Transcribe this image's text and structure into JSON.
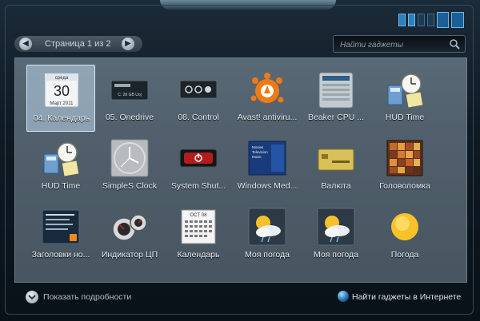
{
  "toolbar": {
    "page_label": "Страница 1 из 2",
    "search_placeholder": "Найти гаджеты"
  },
  "gadgets": [
    {
      "label": "04. Календарь",
      "icon": "calendar-icon",
      "calendar": {
        "month_top": "среда",
        "day": "30",
        "month_year": "Март 2011"
      },
      "selected": true
    },
    {
      "label": "05. Onedrive",
      "icon": "drive-icon",
      "drive_text": "C: 28 GB Uoj"
    },
    {
      "label": "08. Control",
      "icon": "control-icon"
    },
    {
      "label": "Avast! antiviru...",
      "icon": "avast-icon"
    },
    {
      "label": "Beaker CPU ...",
      "icon": "cpu-meter-icon"
    },
    {
      "label": "HUD Time",
      "icon": "clock-calculator-icon"
    },
    {
      "label": "HUD Time",
      "icon": "clock-calculator-icon"
    },
    {
      "label": "SimpleS Clock",
      "icon": "analog-clock-icon"
    },
    {
      "label": "System Shut...",
      "icon": "power-button-icon"
    },
    {
      "label": "Windows Med...",
      "icon": "media-center-icon",
      "media_lines": [
        "Movies",
        "Television",
        "Music"
      ]
    },
    {
      "label": "Валюта",
      "icon": "currency-card-icon"
    },
    {
      "label": "Головоломка",
      "icon": "puzzle-icon"
    },
    {
      "label": "Заголовки но...",
      "icon": "news-feed-icon"
    },
    {
      "label": "Индикатор ЦП",
      "icon": "cpu-gauge-icon"
    },
    {
      "label": "Календарь",
      "icon": "calendar-grid-icon",
      "calendar_header": "OCT 08"
    },
    {
      "label": "Моя погода",
      "icon": "weather-icon"
    },
    {
      "label": "Моя погода",
      "icon": "weather-icon"
    },
    {
      "label": "Погода",
      "icon": "sun-icon"
    }
  ],
  "footer": {
    "details_label": "Показать подробности",
    "online_label": "Найти гаджеты в Интернете"
  },
  "colors": {
    "accent_blue": "#2d7fc0",
    "avast_orange": "#f07a16",
    "shutdown_red": "#b41c1c"
  }
}
